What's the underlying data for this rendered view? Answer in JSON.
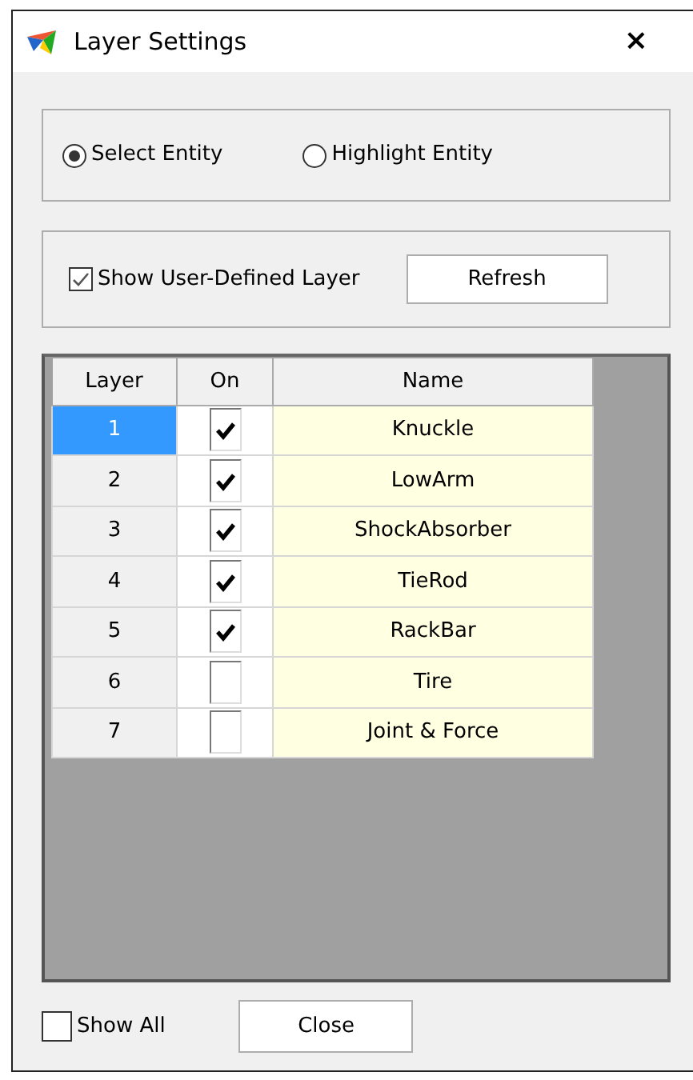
{
  "window": {
    "title": "Layer Settings",
    "close": "×"
  },
  "mode": [
    {
      "label": "Select Entity",
      "selected": true
    },
    {
      "label": "Highlight Entity",
      "selected": false
    }
  ],
  "user_layer": {
    "label": "Show User-Defined Layer",
    "checked": true,
    "button": "Refresh"
  },
  "table": {
    "columns": [
      "Layer",
      "On",
      "Name"
    ],
    "rows": [
      {
        "layer": "1",
        "on": true,
        "name": "Knuckle",
        "selected": true
      },
      {
        "layer": "2",
        "on": true,
        "name": "LowArm",
        "selected": false
      },
      {
        "layer": "3",
        "on": true,
        "name": "ShockAbsorber",
        "selected": false
      },
      {
        "layer": "4",
        "on": true,
        "name": "TieRod",
        "selected": false
      },
      {
        "layer": "5",
        "on": true,
        "name": "RackBar",
        "selected": false
      },
      {
        "layer": "6",
        "on": false,
        "name": "Tire",
        "selected": false
      },
      {
        "layer": "7",
        "on": false,
        "name": "Joint & Force",
        "selected": false
      }
    ]
  },
  "show_all": {
    "label": "Show All",
    "checked": false
  },
  "close_button": "Close"
}
